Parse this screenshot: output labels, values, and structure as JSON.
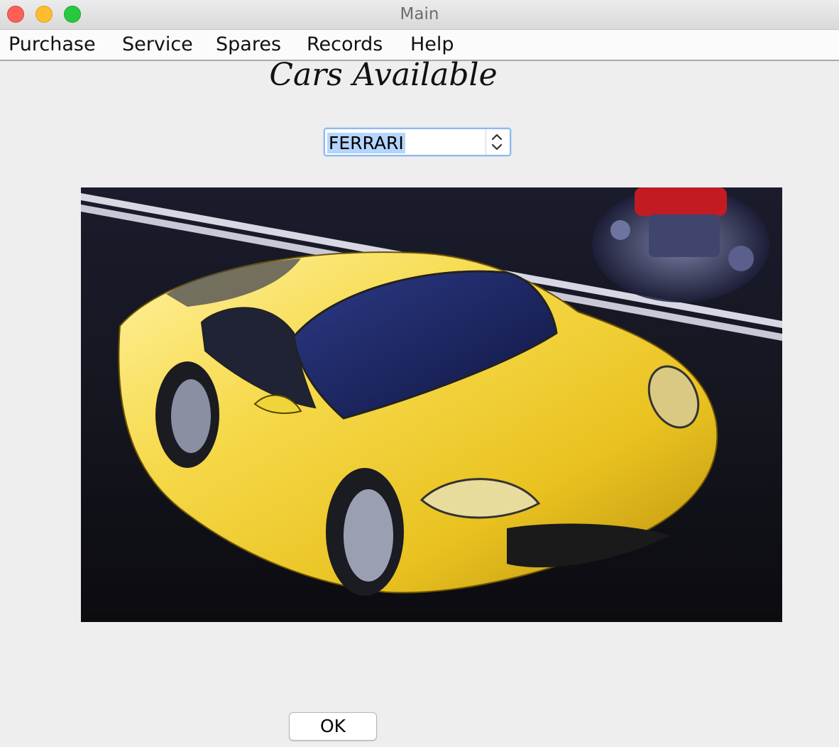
{
  "window": {
    "title": "Main"
  },
  "menubar": {
    "items": [
      {
        "label": "Purchase"
      },
      {
        "label": "Service"
      },
      {
        "label": "Spares"
      },
      {
        "label": "Records"
      },
      {
        "label": "Help"
      }
    ]
  },
  "main": {
    "heading": "Cars Available",
    "car_selector": {
      "value": "FERRARI"
    },
    "image": {
      "subject": "yellow sports car on road with engine inset"
    },
    "ok_label": "OK"
  },
  "colors": {
    "selection_highlight": "#b4d5fe",
    "focus_ring": "#8fb9ee",
    "car_yellow": "#f2cf2a"
  }
}
